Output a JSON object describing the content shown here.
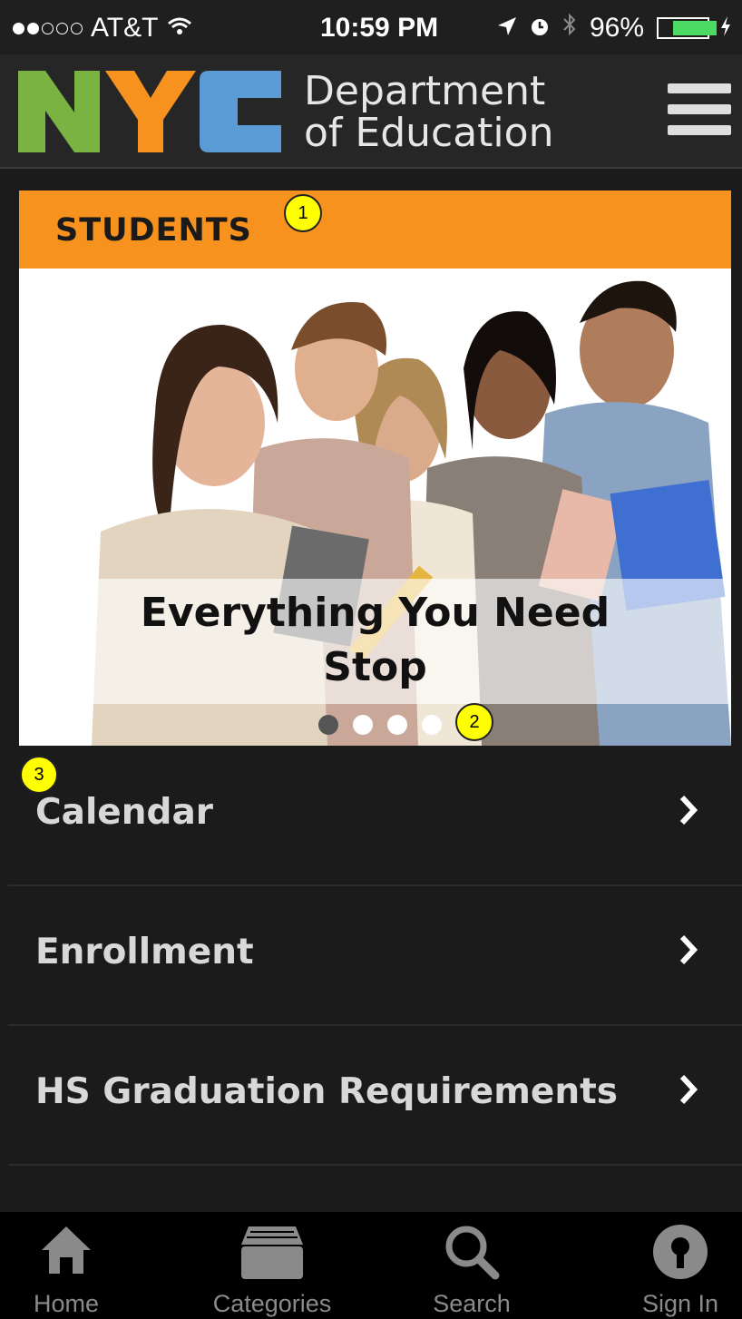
{
  "status_bar": {
    "carrier": "AT&T",
    "time": "10:59 PM",
    "battery": "96%",
    "battery_level": 0.96,
    "signal_bars": 2,
    "icons": [
      "wifi-icon",
      "location-arrow-icon",
      "alarm-icon",
      "bluetooth-icon",
      "battery-icon",
      "charging-icon"
    ]
  },
  "header": {
    "logo": {
      "letters": "NYC",
      "colors": [
        "#7bb342",
        "#f7921e",
        "#5b9bd5"
      ]
    },
    "title_line1": "Department",
    "title_line2": "of Education",
    "menu_icon": "hamburger-icon"
  },
  "section": {
    "title": "STUDENTS",
    "accent": "#f7921e"
  },
  "carousel": {
    "caption_line1": "Everything You Need",
    "caption_line2": "Stop",
    "slide_count": 4,
    "active_index": 0
  },
  "menu_items": [
    {
      "label": "Calendar"
    },
    {
      "label": "Enrollment"
    },
    {
      "label": "HS Graduation Requirements"
    }
  ],
  "tab_bar": {
    "tabs": [
      {
        "label": "Home",
        "icon": "home-icon"
      },
      {
        "label": "Categories",
        "icon": "categories-icon"
      },
      {
        "label": "Search",
        "icon": "search-icon"
      },
      {
        "label": "Sign In",
        "icon": "sign-in-icon"
      }
    ]
  },
  "annotations": [
    "1",
    "2",
    "3"
  ]
}
